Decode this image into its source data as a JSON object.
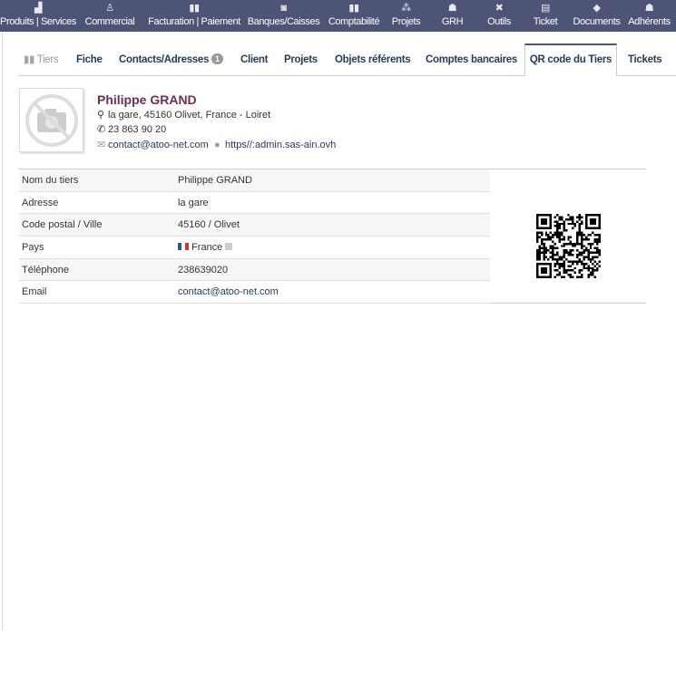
{
  "nav": [
    {
      "label": "Produits | Services",
      "icon": "boxes-icon",
      "glyph": "▟"
    },
    {
      "label": "Commercial",
      "icon": "tie-icon",
      "glyph": "♙"
    },
    {
      "label": "Facturation | Paiement",
      "icon": "bills-icon",
      "glyph": "▮▮"
    },
    {
      "label": "Banques/Caisses",
      "icon": "safe-icon",
      "glyph": "◙"
    },
    {
      "label": "Comptabilité",
      "icon": "ledger-icon",
      "glyph": "▮▮"
    },
    {
      "label": "Projets",
      "icon": "sitemap-icon",
      "glyph": "⁂"
    },
    {
      "label": "GRH",
      "icon": "hr-icon",
      "glyph": "☗"
    },
    {
      "label": "Outils",
      "icon": "tools-icon",
      "glyph": "✖"
    },
    {
      "label": "Ticket",
      "icon": "ticket-icon",
      "glyph": "▤"
    },
    {
      "label": "Documents",
      "icon": "documents-icon",
      "glyph": "◆"
    },
    {
      "label": "Adhérents",
      "icon": "members-icon",
      "glyph": "☗"
    }
  ],
  "tabs": {
    "tiers": "Tiers",
    "items": [
      "Fiche",
      "Contacts/Adresses",
      "Client",
      "Projets",
      "Objets référents",
      "Comptes bancaires",
      "QR code du Tiers",
      "Tickets"
    ],
    "contacts_badge": "1",
    "active": "QR code du Tiers"
  },
  "card": {
    "name": "Philippe GRAND",
    "address": "la gare, 45160 Olivet, France - Loiret",
    "phone": "23 863 90 20",
    "email": "contact@atoo-net.com",
    "url": "https//:admin.sas-ain.ovh"
  },
  "table": [
    {
      "label": "Nom du tiers",
      "value": "Philippe GRAND"
    },
    {
      "label": "Adresse",
      "value": "la gare"
    },
    {
      "label": "Code postal / Ville",
      "value": "45160 / Olivet"
    },
    {
      "label": "Pays",
      "value": "France"
    },
    {
      "label": "Téléphone",
      "value": "238639020"
    },
    {
      "label": "Email",
      "value": "contact@atoo-net.com"
    }
  ]
}
